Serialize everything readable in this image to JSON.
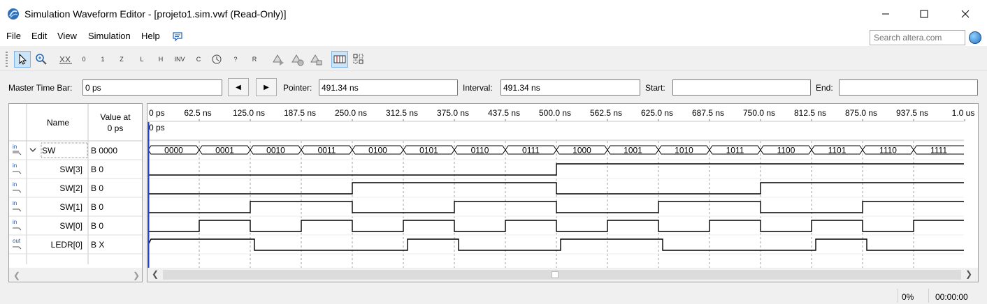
{
  "window": {
    "title": "Simulation Waveform Editor - [projeto1.sim.vwf (Read-Only)]"
  },
  "menu": [
    "File",
    "Edit",
    "View",
    "Simulation",
    "Help"
  ],
  "search": {
    "placeholder": "Search altera.com"
  },
  "toolbar": {
    "tools": [
      "selection-tool",
      "zoom-tool",
      "force-unknown-x",
      "force-low-0",
      "force-high-1",
      "force-high-impedance-z",
      "force-weak-low-l",
      "force-weak-high-h",
      "invert",
      "count-value-c",
      "forcing-clock",
      "random-value",
      "arbitrary-value-r",
      "run-functional-simulation",
      "run-timing-simulation",
      "generate-netlist",
      "snap-to-grid",
      "grid-settings"
    ],
    "labels": {
      "x": "X",
      "zero": "0",
      "one": "1",
      "z": "Z",
      "l": "L",
      "h": "H",
      "inv": "INV",
      "c": "C",
      "r": "R",
      "q": "?"
    }
  },
  "timebar": {
    "master_label": "Master Time Bar:",
    "master_value": "0 ps",
    "pointer_label": "Pointer:",
    "pointer_value": "491.34 ns",
    "interval_label": "Interval:",
    "interval_value": "491.34 ns",
    "start_label": "Start:",
    "start_value": "",
    "end_label": "End:",
    "end_value": ""
  },
  "columns": {
    "name": "Name",
    "value": "Value at",
    "value2": "0 ps"
  },
  "time_marker": "0 ps",
  "time_ticks": [
    "0 ps",
    "62.5 ns",
    "125.0 ns",
    "187.5 ns",
    "250.0 ns",
    "312.5 ns",
    "375.0 ns",
    "437.5 ns",
    "500.0 ns",
    "562.5 ns",
    "625.0 ns",
    "687.5 ns",
    "750.0 ns",
    "812.5 ns",
    "875.0 ns",
    "937.5 ns",
    "1.0 us"
  ],
  "signals": [
    {
      "name": "SW",
      "value": "B 0000",
      "dir": "bus",
      "glyph": "in",
      "expanded": true,
      "bus_values": [
        "0000",
        "0001",
        "0010",
        "0011",
        "0100",
        "0101",
        "0110",
        "0111",
        "1000",
        "1001",
        "1010",
        "1011",
        "1100",
        "1101",
        "1110",
        "1111"
      ]
    },
    {
      "name": "SW[3]",
      "value": "B 0",
      "dir": "in",
      "glyph": "in",
      "levels": [
        0,
        0,
        0,
        0,
        0,
        0,
        0,
        0,
        1,
        1,
        1,
        1,
        1,
        1,
        1,
        1
      ]
    },
    {
      "name": "SW[2]",
      "value": "B 0",
      "dir": "in",
      "glyph": "in",
      "levels": [
        0,
        0,
        0,
        0,
        1,
        1,
        1,
        1,
        0,
        0,
        0,
        0,
        1,
        1,
        1,
        1
      ]
    },
    {
      "name": "SW[1]",
      "value": "B 0",
      "dir": "in",
      "glyph": "in",
      "levels": [
        0,
        0,
        1,
        1,
        0,
        0,
        1,
        1,
        0,
        0,
        1,
        1,
        0,
        0,
        1,
        1
      ]
    },
    {
      "name": "SW[0]",
      "value": "B 0",
      "dir": "in",
      "glyph": "in",
      "levels": [
        0,
        1,
        0,
        1,
        0,
        1,
        0,
        1,
        0,
        1,
        0,
        1,
        0,
        1,
        0,
        1
      ]
    },
    {
      "name": "LEDR[0]",
      "value": "B X",
      "dir": "out",
      "glyph": "out",
      "levels": [
        1,
        1,
        0,
        0,
        0,
        1,
        0,
        0,
        1,
        1,
        0,
        0,
        0,
        1,
        0,
        0
      ]
    }
  ],
  "status": {
    "progress": "0%",
    "elapsed": "00:00:00"
  },
  "colors": {
    "bus": "#000000",
    "grid": "#a0a0a0",
    "cursor": "#1f3fbf",
    "in_icon": "#1e4fb0",
    "out_icon": "#1e4fb0"
  }
}
